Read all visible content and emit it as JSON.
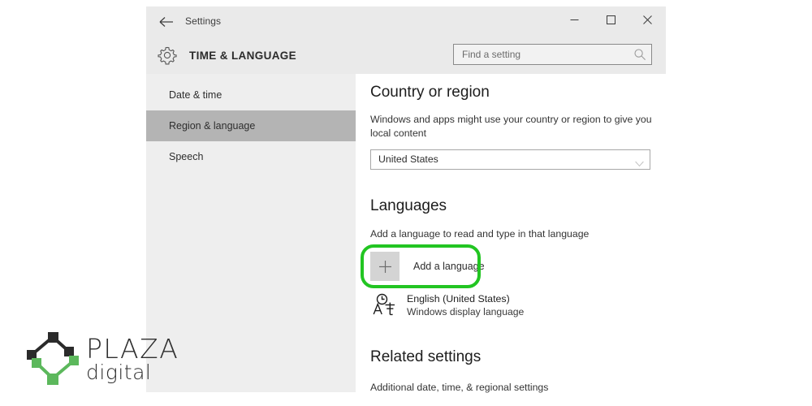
{
  "window": {
    "titlebar": {
      "back_label": "back-arrow",
      "title": "Settings",
      "minimize_label": "Minimize",
      "maximize_label": "Maximize",
      "close_label": "Close"
    },
    "header": {
      "gear_icon": "gear-icon",
      "page_title": "TIME & LANGUAGE"
    },
    "search": {
      "placeholder": "Find a setting",
      "value": "",
      "icon": "search-icon"
    }
  },
  "sidebar": {
    "items": [
      {
        "label": "Date & time",
        "selected": false
      },
      {
        "label": "Region & language",
        "selected": true
      },
      {
        "label": "Speech",
        "selected": false
      }
    ]
  },
  "content": {
    "country": {
      "heading": "Country or region",
      "description": "Windows and apps might use your country or region to give you local content",
      "selected_value": "United States",
      "chevron_icon": "chevron-down-icon"
    },
    "languages": {
      "heading": "Languages",
      "description": "Add a language to read and type in that language",
      "add_button_label": "Add a language",
      "add_button_icon": "plus-icon",
      "installed": [
        {
          "icon": "language-icon",
          "name": "English (United States)",
          "subtitle": "Windows display language"
        }
      ]
    },
    "related": {
      "heading": "Related settings",
      "links": [
        "Additional date, time, & regional settings"
      ]
    }
  },
  "annotation": {
    "target": "add-a-language-button",
    "color": "#22c522"
  },
  "logo": {
    "primary": "PLAZA",
    "secondary": "digital",
    "dark_color": "#2b2b2b",
    "green_color": "#5cb85c"
  }
}
